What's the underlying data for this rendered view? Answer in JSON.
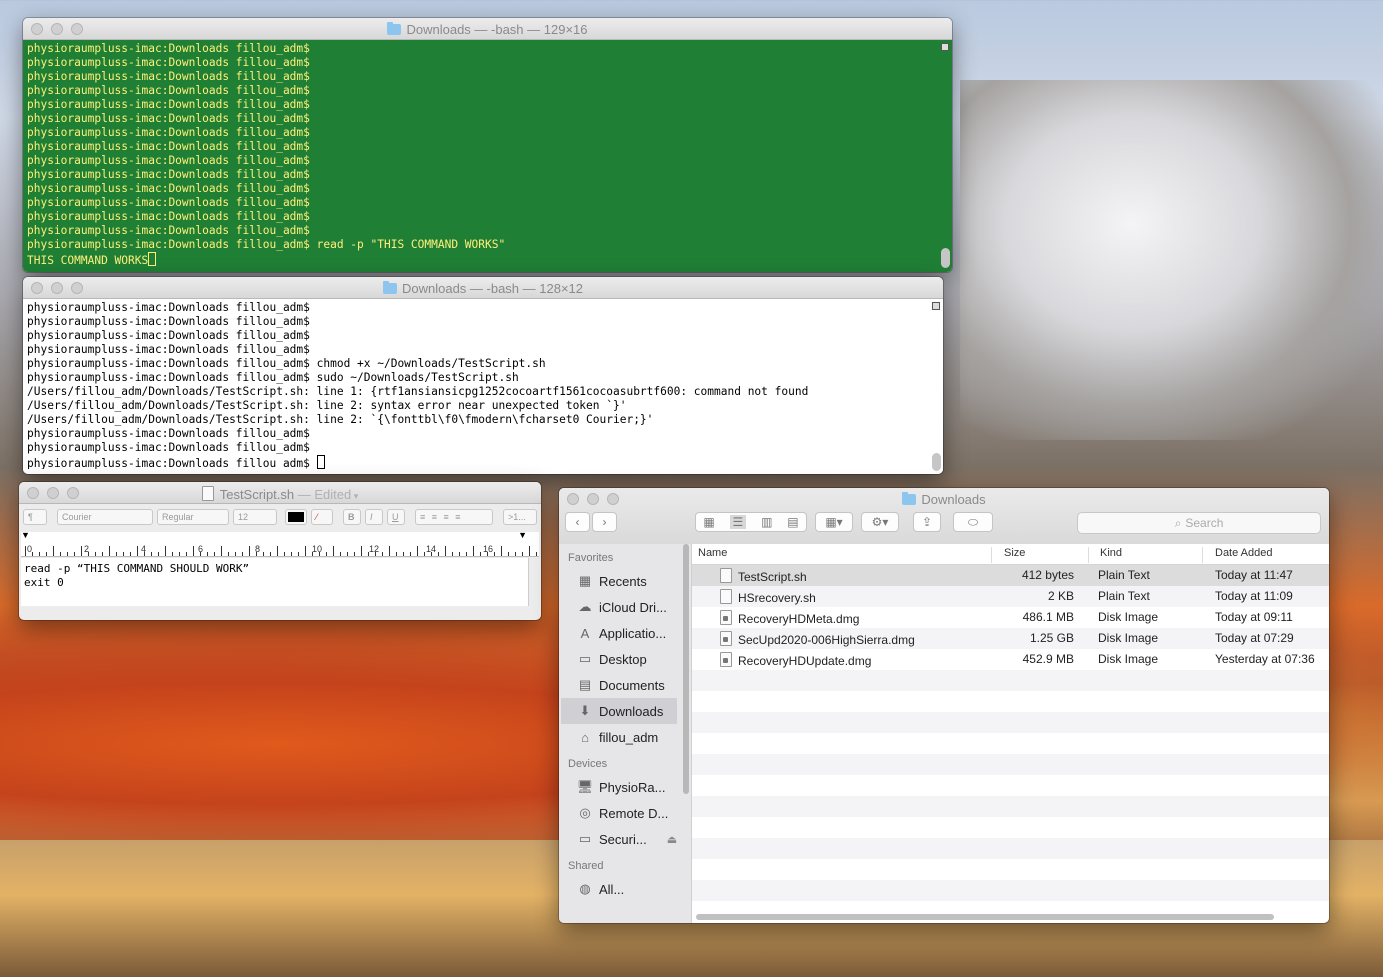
{
  "terminal1": {
    "title": "Downloads — -bash — 129×16",
    "prompt": "physioraumpluss-imac:Downloads fillou_adm$",
    "lines": [
      "physioraumpluss-imac:Downloads fillou_adm$",
      "physioraumpluss-imac:Downloads fillou_adm$",
      "physioraumpluss-imac:Downloads fillou_adm$",
      "physioraumpluss-imac:Downloads fillou_adm$",
      "physioraumpluss-imac:Downloads fillou_adm$",
      "physioraumpluss-imac:Downloads fillou_adm$",
      "physioraumpluss-imac:Downloads fillou_adm$",
      "physioraumpluss-imac:Downloads fillou_adm$",
      "physioraumpluss-imac:Downloads fillou_adm$",
      "physioraumpluss-imac:Downloads fillou_adm$",
      "physioraumpluss-imac:Downloads fillou_adm$",
      "physioraumpluss-imac:Downloads fillou_adm$",
      "physioraumpluss-imac:Downloads fillou_adm$",
      "physioraumpluss-imac:Downloads fillou_adm$",
      "physioraumpluss-imac:Downloads fillou_adm$ read -p \"THIS COMMAND WORKS\""
    ],
    "output": "THIS COMMAND WORKS"
  },
  "terminal2": {
    "title": "Downloads — -bash — 128×12",
    "lines": [
      "physioraumpluss-imac:Downloads fillou_adm$",
      "physioraumpluss-imac:Downloads fillou_adm$",
      "physioraumpluss-imac:Downloads fillou_adm$",
      "physioraumpluss-imac:Downloads fillou_adm$",
      "physioraumpluss-imac:Downloads fillou_adm$ chmod +x ~/Downloads/TestScript.sh",
      "physioraumpluss-imac:Downloads fillou_adm$ sudo ~/Downloads/TestScript.sh",
      "/Users/fillou_adm/Downloads/TestScript.sh: line 1: {rtf1ansiansicpg1252cocoartf1561cocoasubrtf600: command not found",
      "/Users/fillou_adm/Downloads/TestScript.sh: line 2: syntax error near unexpected token `}'",
      "/Users/fillou_adm/Downloads/TestScript.sh: line 2: `{\\fonttbl\\f0\\fmodern\\fcharset0 Courier;}'",
      "physioraumpluss-imac:Downloads fillou_adm$",
      "physioraumpluss-imac:Downloads fillou_adm$"
    ],
    "last_prompt": "physioraumpluss-imac:Downloads fillou_adm$ "
  },
  "textedit": {
    "filename": "TestScript.sh",
    "status": "— Edited",
    "toolbar": {
      "paragraph": "¶",
      "font": "Courier",
      "style": "Regular",
      "size": "12",
      "bold": "B",
      "italic": "I",
      "underline": "U",
      "list": ">1..."
    },
    "ruler_numbers": [
      "0",
      "2",
      "4",
      "6",
      "8",
      "10",
      "12",
      "14",
      "16"
    ],
    "lines": [
      "read -p “THIS COMMAND SHOULD WORK”",
      "exit 0"
    ]
  },
  "finder": {
    "title": "Downloads",
    "search_placeholder": "Search",
    "sidebar": {
      "favorites_label": "Favorites",
      "favorites": [
        {
          "label": "Recents",
          "icon": "recents-icon",
          "glyph": "▦"
        },
        {
          "label": "iCloud Dri...",
          "icon": "cloud-icon",
          "glyph": "☁"
        },
        {
          "label": "Applicatio...",
          "icon": "applications-icon",
          "glyph": "A"
        },
        {
          "label": "Desktop",
          "icon": "desktop-icon",
          "glyph": "▭"
        },
        {
          "label": "Documents",
          "icon": "documents-icon",
          "glyph": "▤"
        },
        {
          "label": "Downloads",
          "icon": "downloads-icon",
          "glyph": "⬇"
        },
        {
          "label": "fillou_adm",
          "icon": "home-icon",
          "glyph": "⌂"
        }
      ],
      "devices_label": "Devices",
      "devices": [
        {
          "label": "PhysioRa...",
          "icon": "imac-icon",
          "glyph": "🖥"
        },
        {
          "label": "Remote D...",
          "icon": "remote-disc-icon",
          "glyph": "◎"
        },
        {
          "label": "Securi...",
          "icon": "disk-icon",
          "glyph": "▭"
        }
      ],
      "shared_label": "Shared",
      "shared": [
        {
          "label": "All...",
          "icon": "network-icon",
          "glyph": "◍"
        }
      ]
    },
    "columns": {
      "name": "Name",
      "size": "Size",
      "kind": "Kind",
      "date": "Date Added"
    },
    "files": [
      {
        "name": "TestScript.sh",
        "size": "412 bytes",
        "kind": "Plain Text",
        "date": "Today at 11:47"
      },
      {
        "name": "HSrecovery.sh",
        "size": "2 KB",
        "kind": "Plain Text",
        "date": "Today at 11:09"
      },
      {
        "name": "RecoveryHDMeta.dmg",
        "size": "486.1 MB",
        "kind": "Disk Image",
        "date": "Today at 09:11"
      },
      {
        "name": "SecUpd2020-006HighSierra.dmg",
        "size": "1.25 GB",
        "kind": "Disk Image",
        "date": "Today at 07:29"
      },
      {
        "name": "RecoveryHDUpdate.dmg",
        "size": "452.9 MB",
        "kind": "Disk Image",
        "date": "Yesterday at 07:36"
      }
    ]
  }
}
